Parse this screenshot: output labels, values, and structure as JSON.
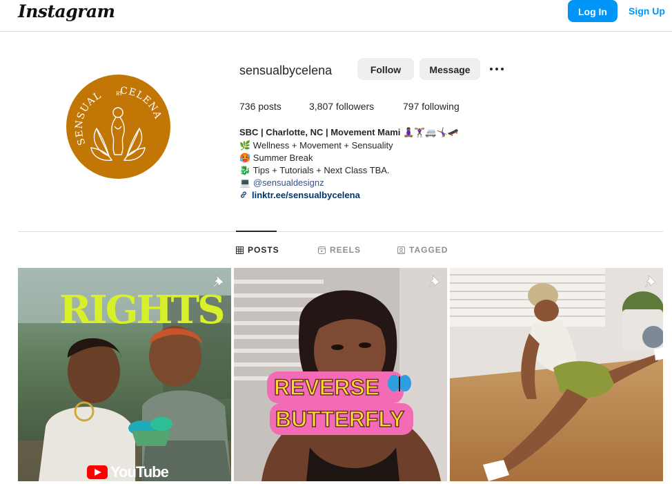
{
  "header": {
    "logo_text": "Instagram",
    "login_label": "Log In",
    "signup_label": "Sign Up"
  },
  "profile": {
    "username": "sensualbycelena",
    "avatar_text_top": "SENSUAL",
    "avatar_text_by": "BY",
    "avatar_text_right": "CELENA",
    "follow_label": "Follow",
    "message_label": "Message",
    "more_icon": "more-dots-icon",
    "stats": {
      "posts": "736 posts",
      "followers": "3,807 followers",
      "following": "797 following"
    },
    "bio": {
      "name_line": "SBC | Charlotte, NC | Movement Mami 🧘🏾‍♀️🏋🏾‍♀️🚐🤸🏾‍♀️🛹",
      "line1": "🌿 Wellness + Movement + Sensuality",
      "line2": "🥵 Summer Break",
      "line3": "🐉 Tips + Tutorials + Next Class TBA.",
      "line4_prefix": "💻 ",
      "line4_mention": "@sensualdesignz",
      "link": "linktr.ee/sensualbycelena"
    }
  },
  "tabs": {
    "posts": "POSTS",
    "reels": "REELS",
    "tagged": "TAGGED"
  },
  "posts": {
    "post1": {
      "headline": "RIGHTS",
      "badge": "YouTube"
    },
    "post2": {
      "line1": "REVERSE",
      "line2": "BUTTERFLY"
    },
    "post3": {}
  },
  "colors": {
    "accent": "#0095f6",
    "avatar_bg": "#c27606",
    "link": "#00376b"
  }
}
